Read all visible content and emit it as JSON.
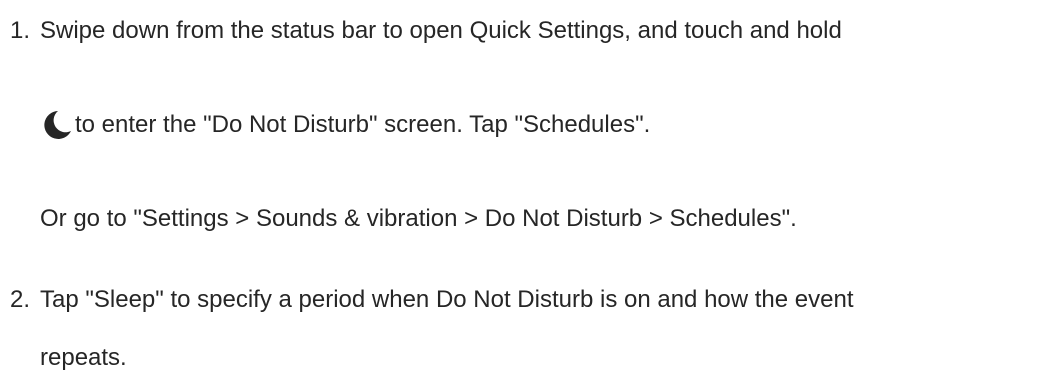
{
  "steps": [
    {
      "number": "1.",
      "line1": "Swipe down from the status bar to open Quick Settings, and touch and hold",
      "icon": "moon-icon",
      "line2": "to enter the \"Do Not Disturb\" screen. Tap \"Schedules\".",
      "alt_path": "Or go to \"Settings > Sounds & vibration > Do Not Disturb > Schedules\"."
    },
    {
      "number": "2.",
      "line1": "Tap \"Sleep\" to specify a period when Do Not Disturb is on and how the event",
      "line2": "repeats."
    }
  ],
  "colors": {
    "text": "#262626",
    "icon": "#262626"
  }
}
